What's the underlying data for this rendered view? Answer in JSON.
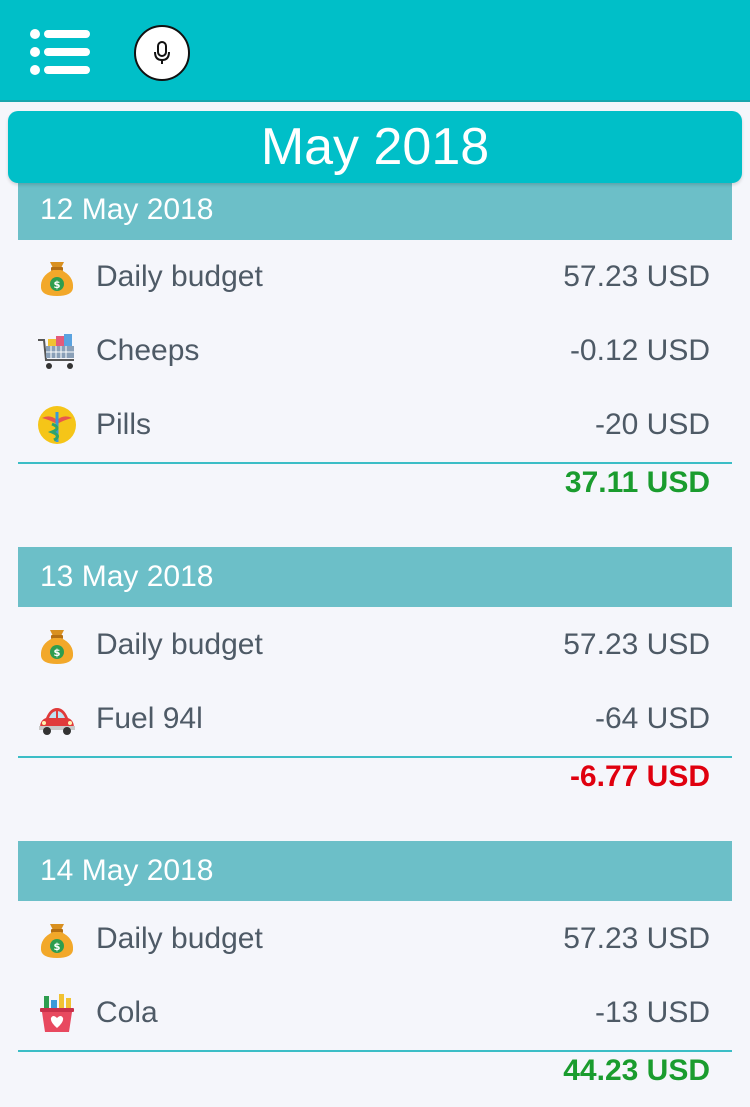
{
  "header": {
    "menu_icon": "menu-list-icon",
    "mic_icon": "microphone-icon",
    "color": "#00bfc8"
  },
  "month": {
    "title": "May 2018"
  },
  "days": [
    {
      "date": "12 May 2018",
      "transactions": [
        {
          "name": "Daily budget",
          "amount": "57.23 USD",
          "icon": "money-bag-icon"
        },
        {
          "name": "Cheeps",
          "amount": "-0.12 USD",
          "icon": "shopping-cart-icon"
        },
        {
          "name": "Pills",
          "amount": "-20 USD",
          "icon": "medical-caduceus-icon"
        }
      ],
      "total": "37.11 USD",
      "total_color": "#1a9c2e"
    },
    {
      "date": "13 May 2018",
      "transactions": [
        {
          "name": "Daily budget",
          "amount": "57.23 USD",
          "icon": "money-bag-icon"
        },
        {
          "name": "Fuel 94l",
          "amount": "-64 USD",
          "icon": "red-car-icon"
        }
      ],
      "total": "-6.77 USD",
      "total_color": "#e0000f"
    },
    {
      "date": "14 May 2018",
      "transactions": [
        {
          "name": "Daily budget",
          "amount": "57.23 USD",
          "icon": "money-bag-icon"
        },
        {
          "name": "Cola",
          "amount": "-13 USD",
          "icon": "grocery-basket-icon"
        }
      ],
      "total": "44.23 USD",
      "total_color": "#1a9c2e"
    }
  ]
}
